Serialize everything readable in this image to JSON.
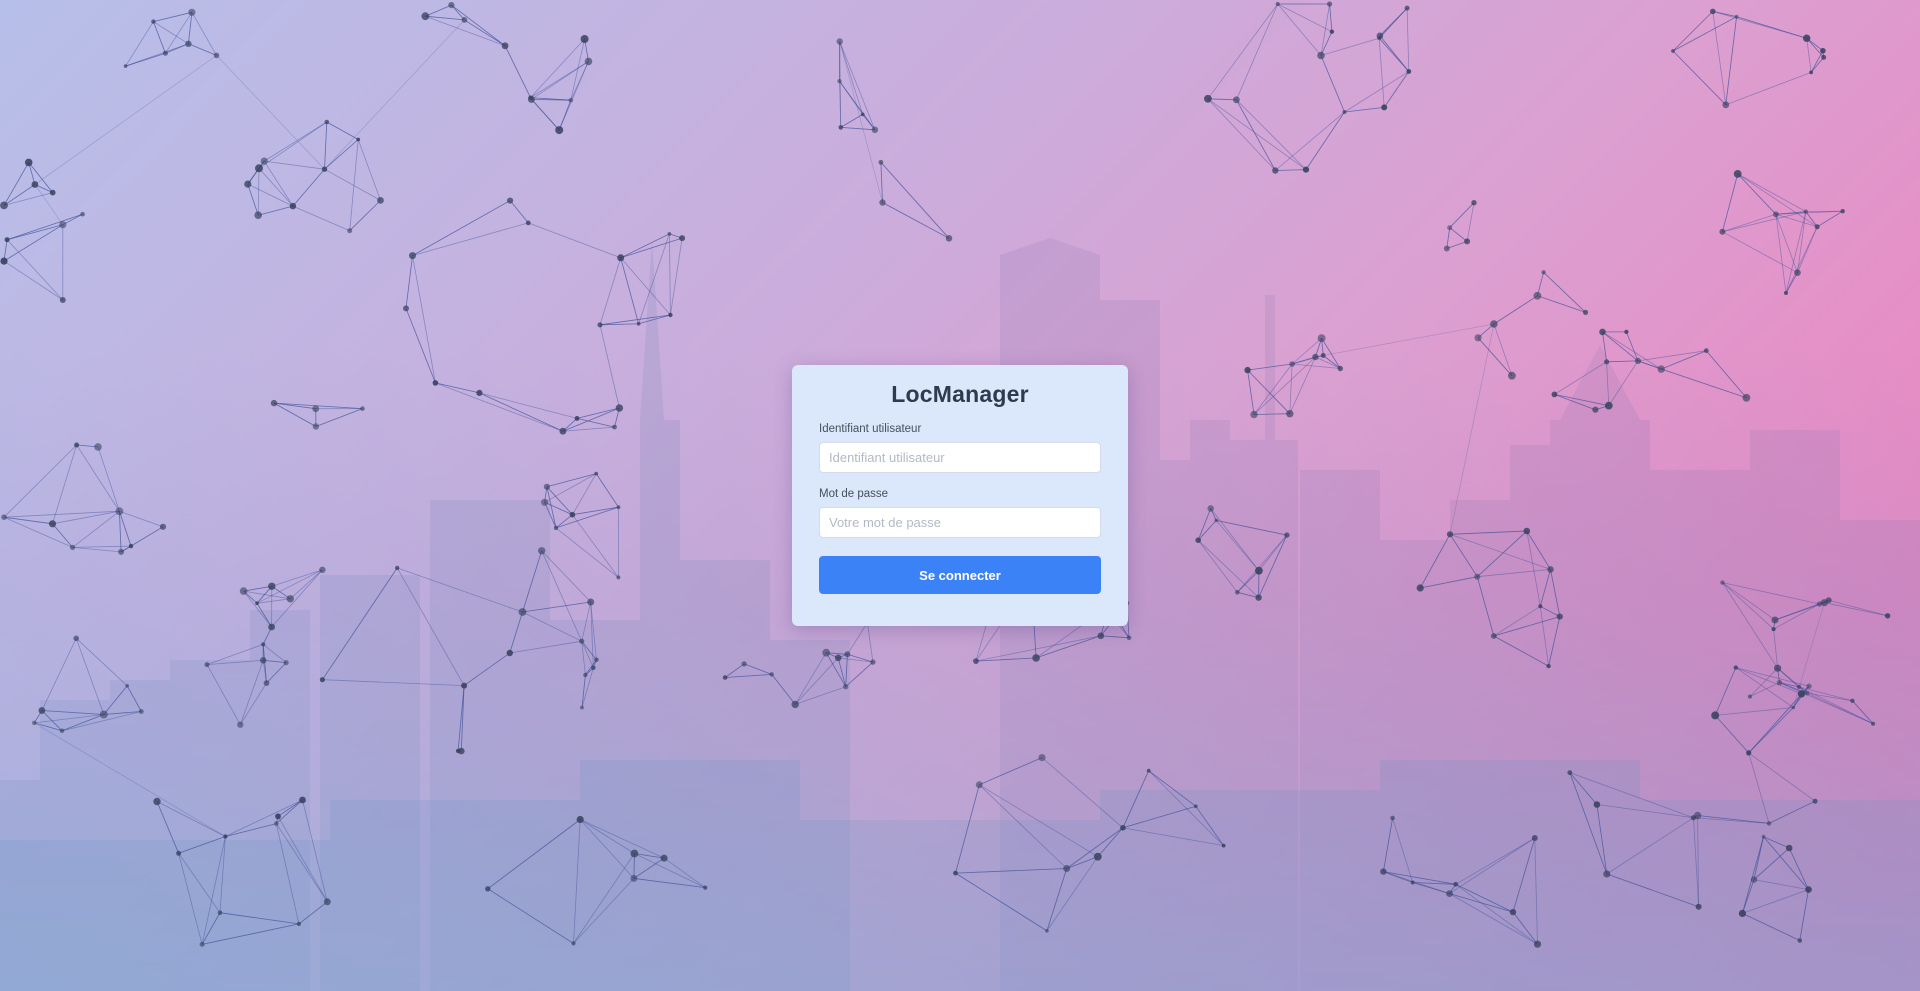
{
  "login": {
    "app_title": "LocManager",
    "username_label": "Identifiant utilisateur",
    "username_placeholder": "Identifiant utilisateur",
    "password_label": "Mot de passe",
    "password_placeholder": "Votre mot de passe",
    "submit_label": "Se connecter"
  },
  "theme": {
    "accent": "#3b82f6",
    "card_background": "#dbe7fb",
    "network_color": "#3e4f96"
  }
}
